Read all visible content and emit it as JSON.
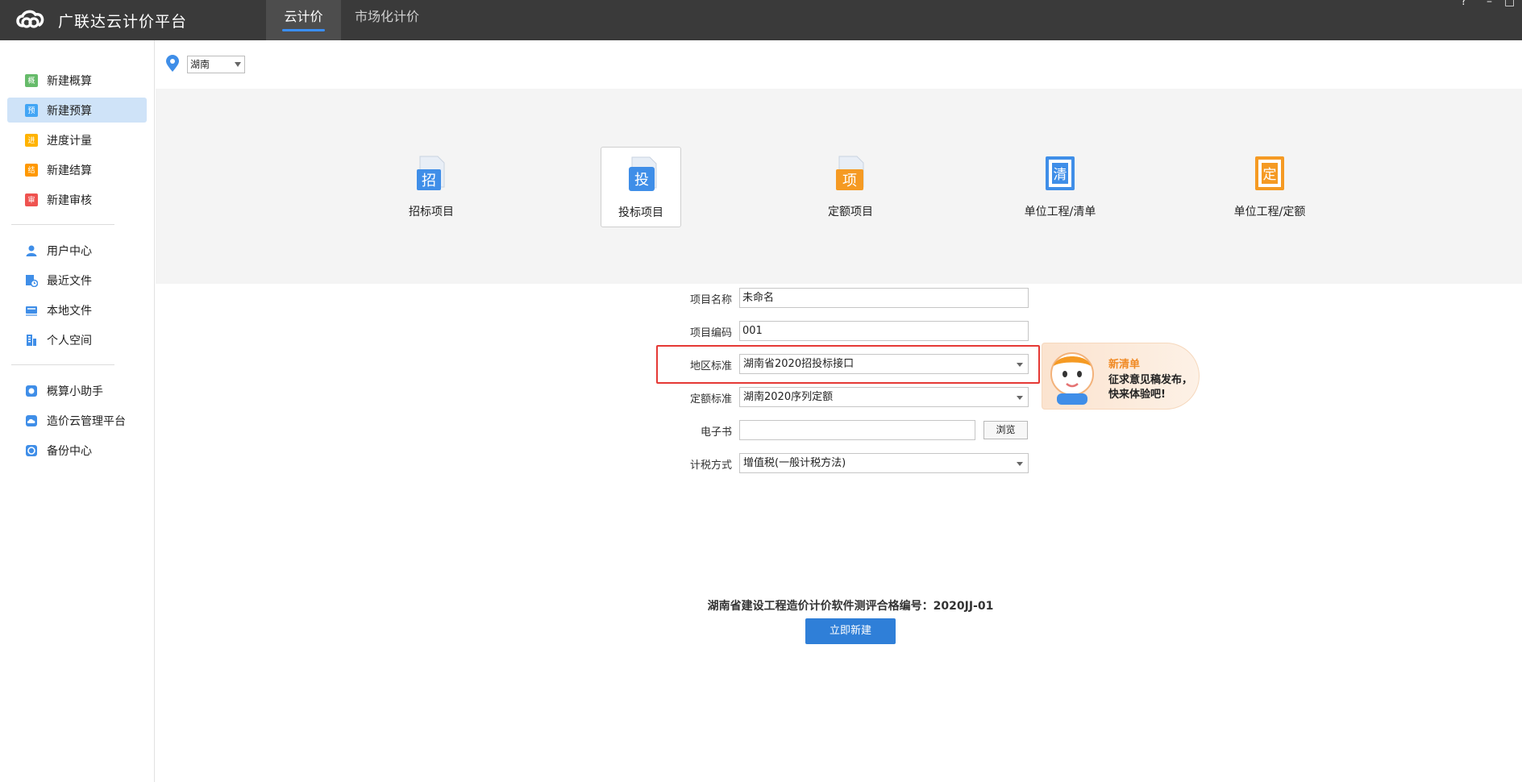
{
  "header": {
    "app_title": "广联达云计价平台",
    "tabs": [
      {
        "label": "云计价",
        "active": true
      },
      {
        "label": "市场化计价",
        "active": false
      }
    ],
    "window_controls": [
      "?",
      "–",
      "□"
    ]
  },
  "sidebar": {
    "groups": [
      {
        "items": [
          {
            "label": "新建概算",
            "icon": "gai-icon",
            "icon_char": "概",
            "color": "#4caf50",
            "active": false
          },
          {
            "label": "新建预算",
            "icon": "yu-icon",
            "icon_char": "预",
            "color": "#42a5f5",
            "active": true
          },
          {
            "label": "进度计量",
            "icon": "jin-icon",
            "icon_char": "进",
            "color": "#ffb300",
            "active": false
          },
          {
            "label": "新建结算",
            "icon": "jie-icon",
            "icon_char": "结",
            "color": "#ff9800",
            "active": false
          },
          {
            "label": "新建审核",
            "icon": "shen-icon",
            "icon_char": "审",
            "color": "#ef5350",
            "active": false
          }
        ]
      },
      {
        "items": [
          {
            "label": "用户中心",
            "icon": "user-icon"
          },
          {
            "label": "最近文件",
            "icon": "recent-file-icon"
          },
          {
            "label": "本地文件",
            "icon": "local-file-icon"
          },
          {
            "label": "个人空间",
            "icon": "personal-space-icon"
          }
        ]
      },
      {
        "items": [
          {
            "label": "概算小助手",
            "icon": "assistant-icon"
          },
          {
            "label": "造价云管理平台",
            "icon": "cloud-platform-icon"
          },
          {
            "label": "备份中心",
            "icon": "backup-icon"
          }
        ]
      }
    ]
  },
  "region": {
    "selected": "湖南"
  },
  "project_types": [
    {
      "label": "招标项目",
      "icon": "zhao-bid-icon",
      "char": "招",
      "color": "#3f8ee8",
      "selected": false
    },
    {
      "label": "投标项目",
      "icon": "tou-bid-icon",
      "char": "投",
      "color": "#3f8ee8",
      "selected": true
    },
    {
      "label": "定额项目",
      "icon": "quota-project-icon",
      "char": "项",
      "color": "#f59a23",
      "selected": false
    },
    {
      "label": "单位工程/清单",
      "icon": "unit-bill-icon",
      "char": "清",
      "color": "#3f8ee8",
      "selected": false
    },
    {
      "label": "单位工程/定额",
      "icon": "unit-quota-icon",
      "char": "定",
      "color": "#f59a23",
      "selected": false
    }
  ],
  "form": {
    "project_name": {
      "label": "项目名称",
      "value": "未命名"
    },
    "project_code": {
      "label": "项目编码",
      "value": "001"
    },
    "region_standard": {
      "label": "地区标准",
      "value": "湖南省2020招投标接口"
    },
    "quota_standard": {
      "label": "定额标准",
      "value": "湖南2020序列定额"
    },
    "ebook": {
      "label": "电子书",
      "value": "",
      "browse_label": "浏览"
    },
    "tax_method": {
      "label": "计税方式",
      "value": "增值税(一般计税方法)"
    }
  },
  "promo": {
    "title": "新清单",
    "line1": "征求意见稿发布，",
    "line2": "快来体验吧!"
  },
  "footer": {
    "certificate": "湖南省建设工程造价计价软件测评合格编号：2020JJ-01",
    "create_button": "立即新建"
  },
  "colors": {
    "topbar": "#3a3a3a",
    "accent": "#2f7fd8",
    "highlight": "#e53935"
  }
}
